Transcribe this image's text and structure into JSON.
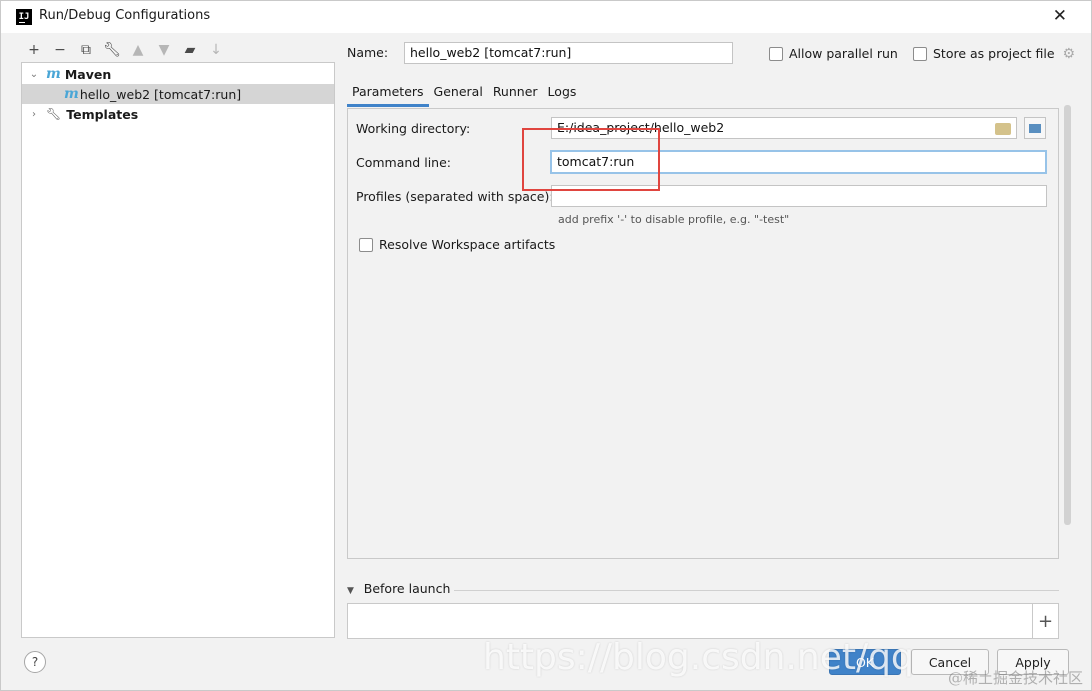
{
  "window": {
    "title": "Run/Debug Configurations",
    "icon_text": "IJ"
  },
  "toolbar": {
    "add_icon": "plus-icon",
    "remove_icon": "minus-icon",
    "copy_icon": "copy-icon",
    "edit_defaults_icon": "wrench-icon",
    "move_up_icon": "arrow-up-icon",
    "move_down_icon": "arrow-down-icon",
    "folder_icon": "folder-icon",
    "sort_icon": "sort-icon"
  },
  "tree": {
    "maven_label": "Maven",
    "config_label": "hello_web2 [tomcat7:run]",
    "templates_label": "Templates"
  },
  "header": {
    "name_label": "Name:",
    "name_value": "hello_web2 [tomcat7:run]",
    "allow_parallel_label": "Allow parallel run",
    "store_project_label": "Store as project file"
  },
  "tabs": [
    "Parameters",
    "General",
    "Runner",
    "Logs"
  ],
  "parameters": {
    "working_dir_label": "Working directory:",
    "working_dir_value": "E:/idea_project/hello_web2",
    "command_line_label": "Command line:",
    "command_line_value": "tomcat7:run",
    "profiles_label": "Profiles (separated with space):",
    "profiles_value": "",
    "profiles_hint": "add prefix '-' to disable profile, e.g. \"-test\"",
    "resolve_workspace_label": "Resolve Workspace artifacts"
  },
  "before_launch": {
    "label": "Before launch"
  },
  "footer": {
    "help_label": "?",
    "ok_label": "OK",
    "cancel_label": "Cancel",
    "apply_label": "Apply"
  },
  "watermark": {
    "text": "https://blog.csdn.net/qq",
    "secondary": "@稀土掘金技术社区"
  },
  "colors": {
    "accent": "#4083c9",
    "highlight": "#e0453f",
    "maven": "#4aa6d6"
  }
}
